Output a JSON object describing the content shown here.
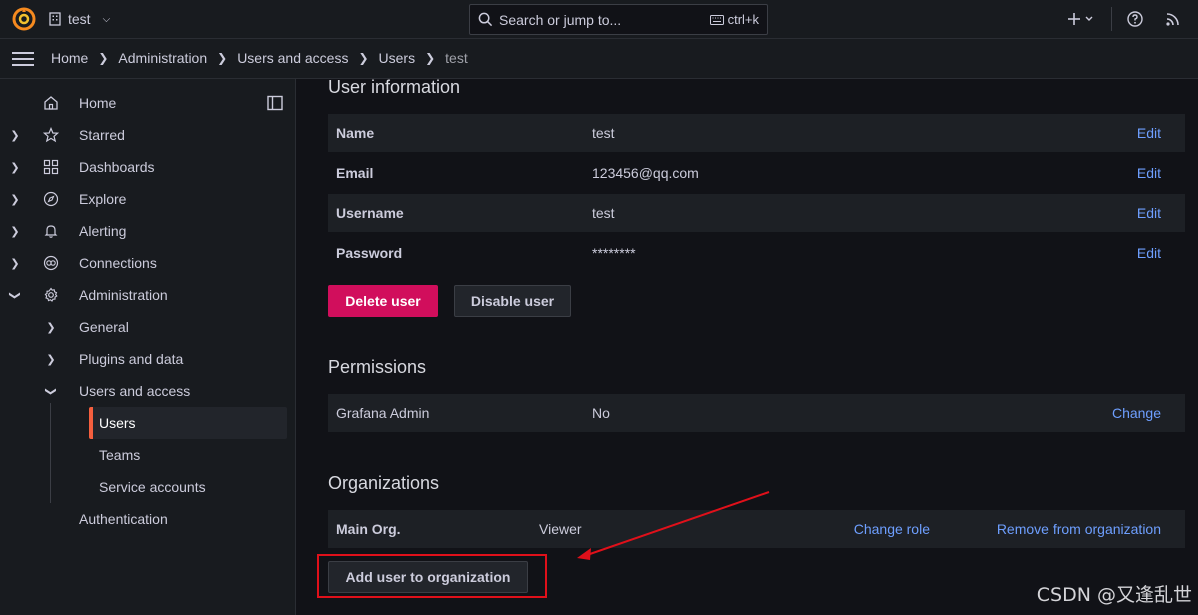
{
  "topbar": {
    "org_name": "test",
    "search_placeholder": "Search or jump to...",
    "search_shortcut": "ctrl+k"
  },
  "breadcrumb": [
    "Home",
    "Administration",
    "Users and access",
    "Users",
    "test"
  ],
  "sidebar": {
    "items": [
      {
        "label": "Home",
        "icon": "home-icon"
      },
      {
        "label": "Starred",
        "icon": "star-icon"
      },
      {
        "label": "Dashboards",
        "icon": "apps-icon"
      },
      {
        "label": "Explore",
        "icon": "compass-icon"
      },
      {
        "label": "Alerting",
        "icon": "bell-icon"
      },
      {
        "label": "Connections",
        "icon": "connections-icon"
      },
      {
        "label": "Administration",
        "icon": "cog-icon"
      }
    ],
    "admin_sub": [
      "General",
      "Plugins and data",
      "Users and access"
    ],
    "users_sub": [
      "Users",
      "Teams",
      "Service accounts"
    ],
    "authentication": "Authentication"
  },
  "user_info": {
    "title": "User information",
    "rows": [
      {
        "key": "Name",
        "value": "test",
        "action": "Edit"
      },
      {
        "key": "Email",
        "value": "123456@qq.com",
        "action": "Edit"
      },
      {
        "key": "Username",
        "value": "test",
        "action": "Edit"
      },
      {
        "key": "Password",
        "value": "********",
        "action": "Edit"
      }
    ],
    "delete_label": "Delete user",
    "disable_label": "Disable user"
  },
  "permissions": {
    "title": "Permissions",
    "row": {
      "key": "Grafana Admin",
      "value": "No",
      "action": "Change"
    }
  },
  "organizations": {
    "title": "Organizations",
    "row": {
      "org": "Main Org.",
      "role": "Viewer",
      "change_role": "Change role",
      "remove": "Remove from organization"
    },
    "add_label": "Add user to organization"
  },
  "watermark": "CSDN @又逢乱世",
  "colors": {
    "accent": "#6e9fff",
    "danger": "#d10e5c",
    "active_bar": "#f55f3e",
    "annotation": "#e0101a"
  }
}
